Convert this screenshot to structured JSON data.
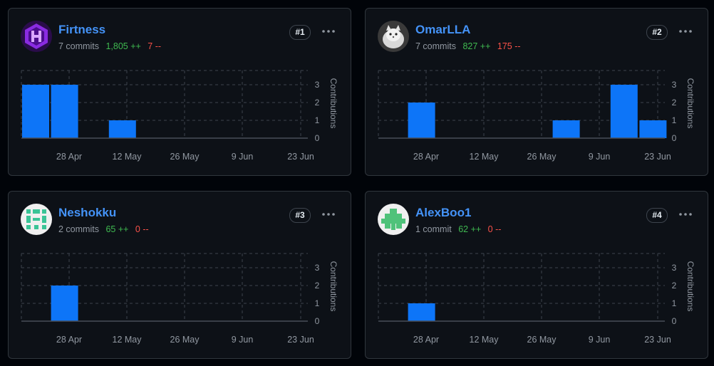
{
  "contributors": [
    {
      "name": "Firtness",
      "commits": "7 commits",
      "additions": "1,805 ++",
      "deletions": "7 --",
      "rank": "#1",
      "avatar": "purple-hex-logo-icon",
      "chart_data": {
        "type": "bar",
        "y_axis_label": "Contributions",
        "y_ticks": [
          "0",
          "1",
          "2",
          "3"
        ],
        "ylim": [
          0,
          3.8
        ],
        "x_ticks": [
          "28 Apr",
          "12 May",
          "26 May",
          "9 Jun",
          "23 Jun"
        ],
        "bars": [
          {
            "week": 0,
            "value": 3
          },
          {
            "week": 1,
            "value": 3
          },
          {
            "week": 3,
            "value": 1
          }
        ]
      }
    },
    {
      "name": "OmarLLA",
      "commits": "7 commits",
      "additions": "827 ++",
      "deletions": "175 --",
      "rank": "#2",
      "avatar": "white-cat-photo-icon",
      "chart_data": {
        "type": "bar",
        "y_axis_label": "Contributions",
        "y_ticks": [
          "0",
          "1",
          "2",
          "3"
        ],
        "ylim": [
          0,
          3.8
        ],
        "x_ticks": [
          "28 Apr",
          "12 May",
          "26 May",
          "9 Jun",
          "23 Jun"
        ],
        "bars": [
          {
            "week": 1,
            "value": 2
          },
          {
            "week": 6,
            "value": 1
          },
          {
            "week": 8,
            "value": 3
          },
          {
            "week": 9,
            "value": 1
          }
        ]
      }
    },
    {
      "name": "Neshokku",
      "commits": "2 commits",
      "additions": "65 ++",
      "deletions": "0 --",
      "rank": "#3",
      "avatar": "green-identicon-icon",
      "chart_data": {
        "type": "bar",
        "y_axis_label": "Contributions",
        "y_ticks": [
          "0",
          "1",
          "2",
          "3"
        ],
        "ylim": [
          0,
          3.8
        ],
        "x_ticks": [
          "28 Apr",
          "12 May",
          "26 May",
          "9 Jun",
          "23 Jun"
        ],
        "bars": [
          {
            "week": 1,
            "value": 2
          }
        ]
      }
    },
    {
      "name": "AlexBoo1",
      "commits": "1 commit",
      "additions": "62 ++",
      "deletions": "0 --",
      "rank": "#4",
      "avatar": "green-identicon-icon",
      "chart_data": {
        "type": "bar",
        "y_axis_label": "Contributions",
        "y_ticks": [
          "0",
          "1",
          "2",
          "3"
        ],
        "ylim": [
          0,
          3.8
        ],
        "x_ticks": [
          "28 Apr",
          "12 May",
          "26 May",
          "9 Jun",
          "23 Jun"
        ],
        "bars": [
          {
            "week": 1,
            "value": 1
          }
        ]
      }
    }
  ],
  "colors": {
    "bar": "#0d75f8",
    "link": "#4493f8",
    "additions": "#3fb950",
    "deletions": "#f85149",
    "muted": "#9198a1",
    "grid": "#3d444d"
  }
}
